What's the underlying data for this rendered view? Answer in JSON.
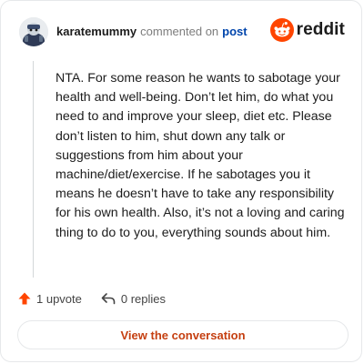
{
  "comment": {
    "username": "karatemummy",
    "action_text": "commented on",
    "post_link_text": "post",
    "body": "NTA. For some reason he wants to sabotage your health and well-being. Don’t let him, do what you need to and improve your sleep, diet etc. Please don’t listen to him, shut down any talk or suggestions from him about your machine/diet/exercise. If he sabotages you it means he doesn’t have to take any responsibility for his own health. Also, it’s not a loving and caring thing to do to you, everything sounds about him.",
    "upvote_label": "1 upvote",
    "replies_label": "0 replies"
  },
  "brand": {
    "logo_text": "reddit",
    "accent_color": "#ff4500"
  },
  "cta": {
    "label": "View the conversation",
    "color": "#c53f10"
  },
  "icons": {
    "avatar": "user-avatar",
    "logo": "reddit-snoo-icon",
    "upvote": "upvote-arrow-icon",
    "reply": "reply-arrow-icon"
  }
}
